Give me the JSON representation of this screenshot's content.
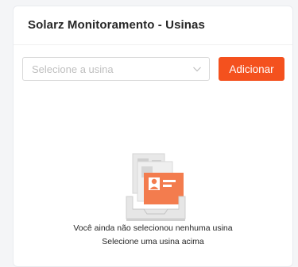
{
  "card": {
    "title": "Solarz Monitoramento - Usinas"
  },
  "form": {
    "select_placeholder": "Selecione a usina",
    "add_button_label": "Adicionar"
  },
  "empty_state": {
    "illustration_icon": "empty-documents-icon",
    "line1": "Você ainda não selecionou nenhuma usina",
    "line2": "Selecione uma usina acima"
  },
  "colors": {
    "accent": "#f4511e",
    "placeholder": "#bfbfbf",
    "title": "#262626"
  }
}
